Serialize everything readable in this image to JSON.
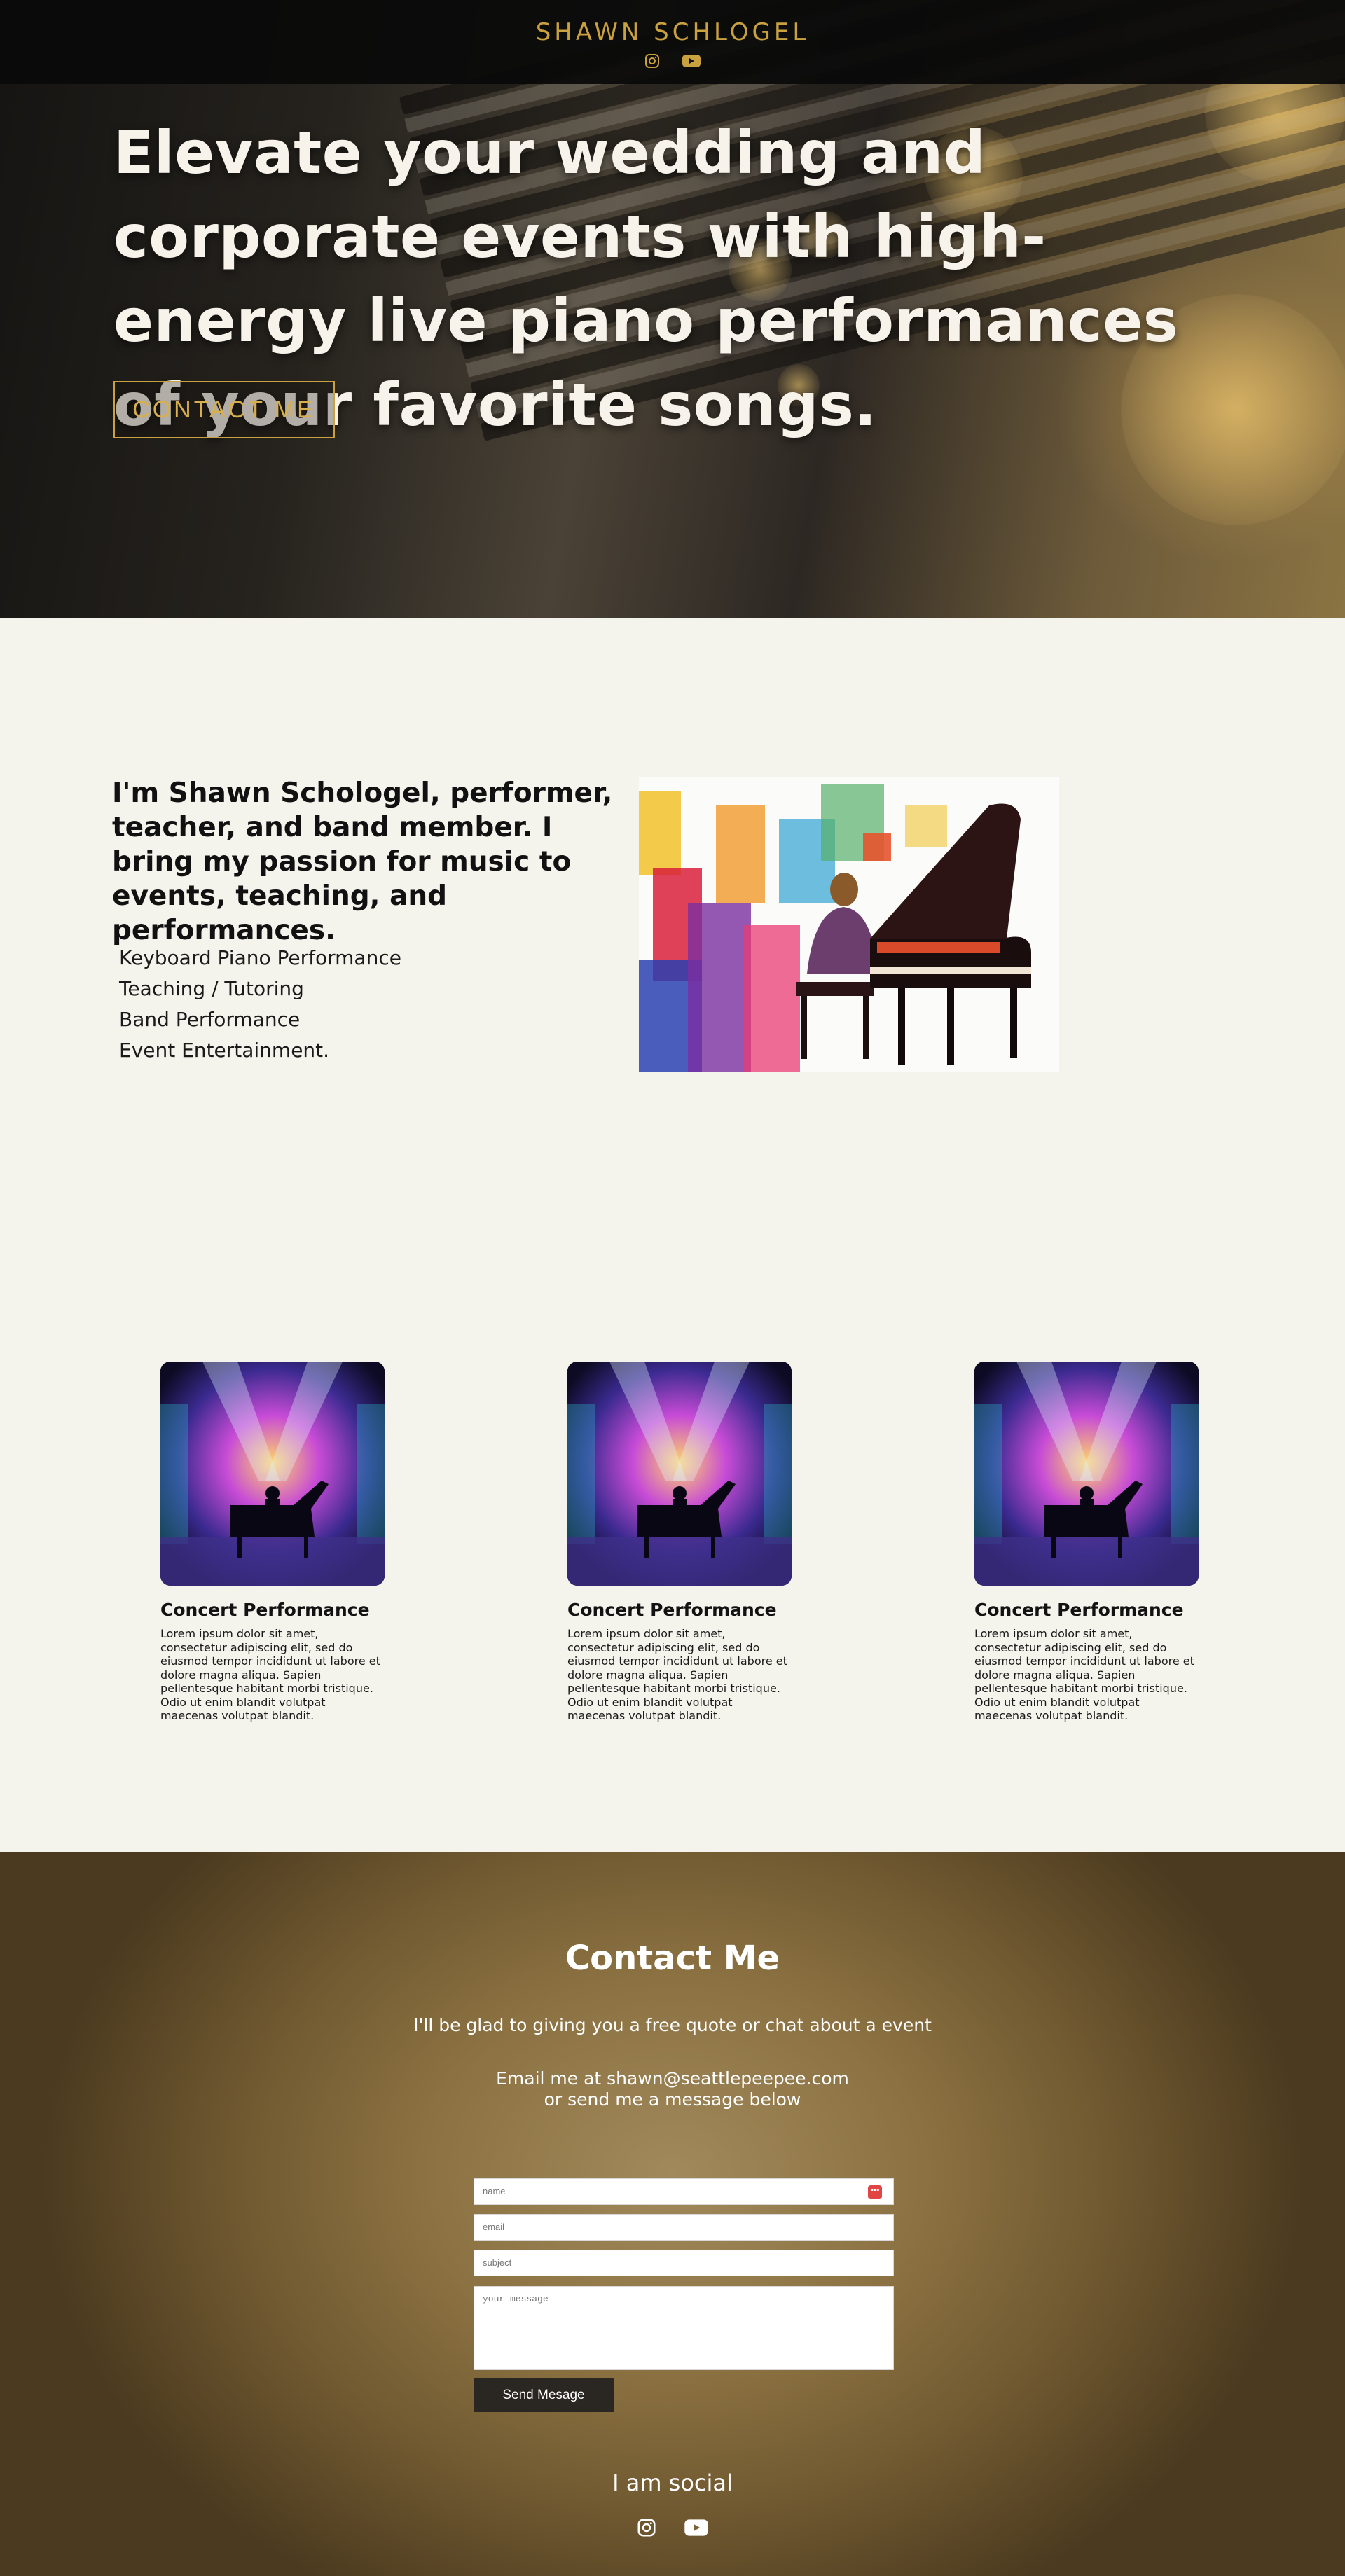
{
  "header": {
    "brand": "SHAWN SCHLOGEL",
    "icons": [
      "instagram-icon",
      "youtube-icon"
    ]
  },
  "hero": {
    "title": "Elevate your wedding and corporate events with high-energy live piano performances of your favorite songs.",
    "cta_label": "CONTACT ME"
  },
  "about": {
    "heading": "I'm Shawn Schologel, performer, teacher, and band member. I bring my passion for music to events, teaching, and performances.",
    "services": [
      "Keyboard Piano Performance",
      "Teaching / Tutoring",
      "Band Performance",
      "Event Entertainment."
    ]
  },
  "cards": [
    {
      "title": "Concert Performance",
      "text": "Lorem ipsum dolor sit amet, consectetur adipiscing elit, sed do eiusmod tempor incididunt ut labore et dolore magna aliqua. Sapien pellentesque habitant morbi tristique. Odio ut enim blandit volutpat maecenas volutpat blandit."
    },
    {
      "title": "Concert Performance",
      "text": "Lorem ipsum dolor sit amet, consectetur adipiscing elit, sed do eiusmod tempor incididunt ut labore et dolore magna aliqua. Sapien pellentesque habitant morbi tristique. Odio ut enim blandit volutpat maecenas volutpat blandit."
    },
    {
      "title": "Concert Performance",
      "text": "Lorem ipsum dolor sit amet, consectetur adipiscing elit, sed do eiusmod tempor incididunt ut labore et dolore magna aliqua. Sapien pellentesque habitant morbi tristique. Odio ut enim blandit volutpat maecenas volutpat blandit."
    }
  ],
  "contact": {
    "title": "Contact Me",
    "subtitle": "I'll be glad to giving you a free quote or chat about a event",
    "email_line": "Email me at shawn@seattlepeepee.com",
    "send_line": "or send me a message below",
    "form": {
      "name_placeholder": "name",
      "email_placeholder": "email",
      "subject_placeholder": "subject",
      "message_placeholder": "your message",
      "submit_label": "Send Mesage"
    },
    "social_label": "I am social"
  },
  "colors": {
    "gold_accent": "#c9a13f",
    "page_bg": "#f4f3ec",
    "header_bg": "#0a0a0a",
    "contact_bg": "#8c7242",
    "button_dark": "#2a2622"
  }
}
